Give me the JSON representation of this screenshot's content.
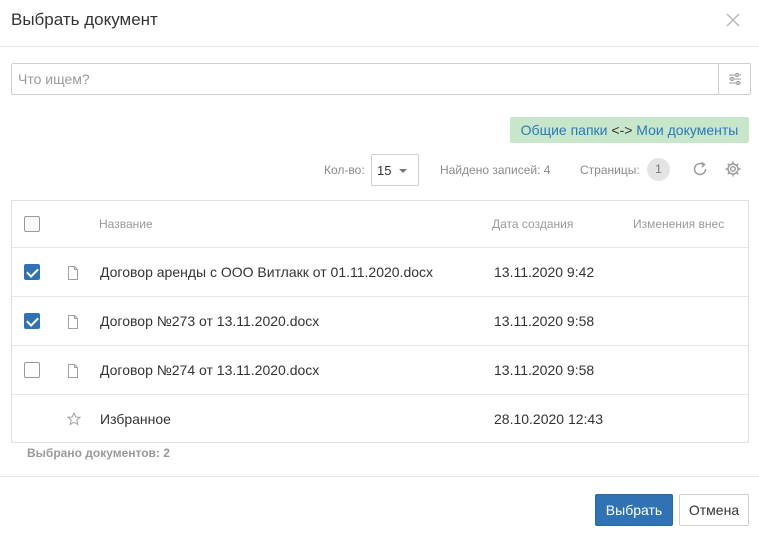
{
  "dialog": {
    "title": "Выбрать документ"
  },
  "search": {
    "placeholder": "Что ищем?",
    "value": ""
  },
  "switch": {
    "left": "Общие папки",
    "arrow": "<->",
    "right": "Мои документы",
    "background": "#c8e6c9",
    "link_color": "#2a7ab8"
  },
  "toolbar": {
    "count_label": "Кол-во:",
    "count_value": "15",
    "found": "Найдено записей: 4",
    "pages_label": "Страницы:",
    "page": "1",
    "refresh_icon": "refresh-icon",
    "settings_icon": "gear-icon"
  },
  "table": {
    "columns": [
      "Название",
      "Дата создания",
      "Изменения внес"
    ],
    "rows": [
      {
        "checked": true,
        "icon": "file-icon",
        "name": "Договор аренды с ООО Витлакк от 01.11.2020.docx",
        "date": "13.11.2020 9:42",
        "changed_by": ""
      },
      {
        "checked": true,
        "icon": "file-icon",
        "name": "Договор №273 от 13.11.2020.docx",
        "date": "13.11.2020 9:58",
        "changed_by": ""
      },
      {
        "checked": false,
        "icon": "file-icon",
        "name": "Договор №274 от 13.11.2020.docx",
        "date": "13.11.2020 9:58",
        "changed_by": ""
      },
      {
        "checked": null,
        "icon": "star-icon",
        "name": "Избранное",
        "date": "28.10.2020 12:43",
        "changed_by": ""
      }
    ]
  },
  "selected_count": "Выбрано документов: 2",
  "footer": {
    "select_label": "Выбрать",
    "cancel_label": "Отмена",
    "accent": "#2f73b5"
  }
}
